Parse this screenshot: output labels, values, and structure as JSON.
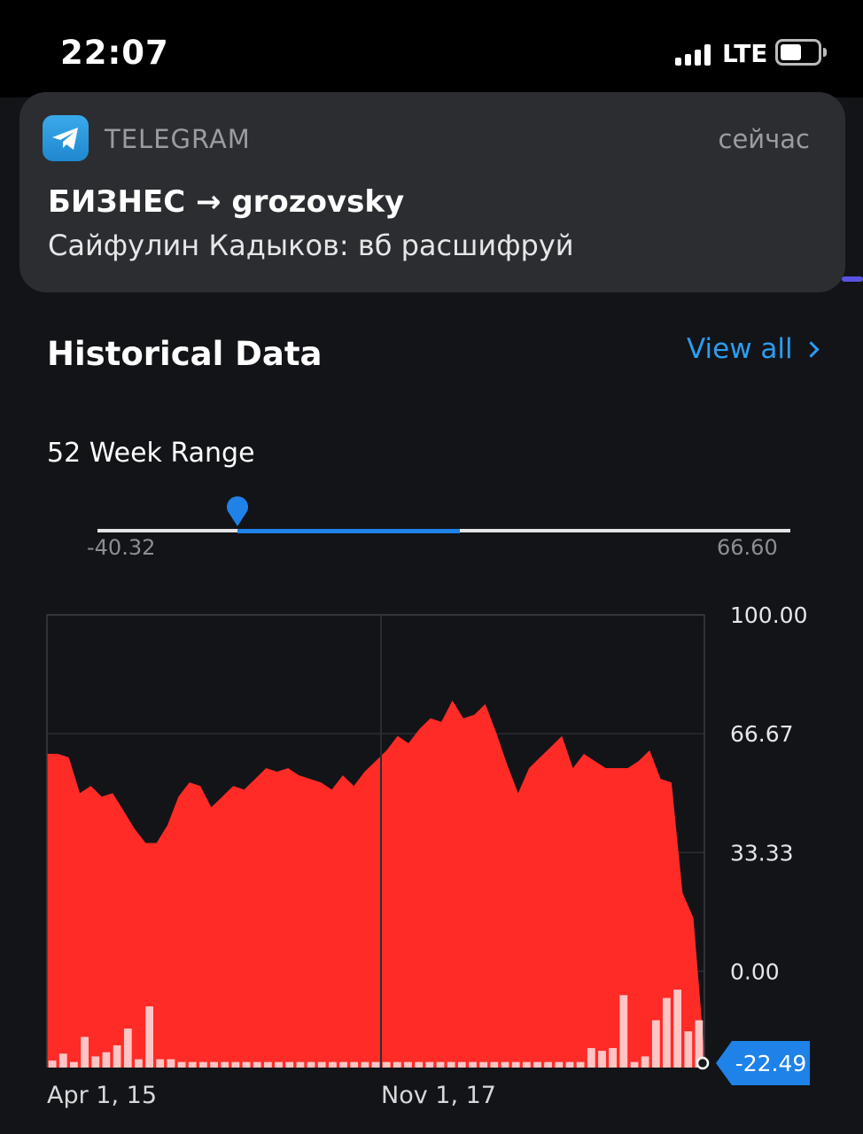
{
  "status_bar": {
    "time": "22:07",
    "network": "LTE"
  },
  "notification": {
    "app_name": "TELEGRAM",
    "time": "сейчас",
    "title": "БИЗНЕС → grozovsky",
    "body": "Сайфулин Кадыков: вб расшифруй"
  },
  "section": {
    "title": "Historical Data",
    "view_all": "View all"
  },
  "range": {
    "label": "52 Week Range",
    "min": "-40.32",
    "max": "66.60"
  },
  "colors": {
    "area": "#fe2b26",
    "accent": "#1e82e8",
    "link": "#2c9df0",
    "volume": "#ffc4c4"
  },
  "chart_data": {
    "type": "area",
    "x_tick_labels": [
      "Apr 1, 15",
      "Nov 1, 17"
    ],
    "y_tick_labels": [
      "100.00",
      "66.67",
      "33.33",
      "0.00"
    ],
    "ylim": [
      -27,
      100
    ],
    "current_value": "-22.49",
    "series": [
      {
        "values": [
          61,
          61,
          60,
          50,
          52,
          49,
          50,
          45,
          40,
          36,
          36,
          41,
          49,
          53,
          52,
          46,
          49,
          52,
          51,
          54,
          57,
          56,
          57,
          55,
          54,
          53,
          51,
          55,
          52,
          56,
          59,
          62,
          66,
          64,
          68,
          71,
          70,
          76,
          71,
          72,
          75,
          67,
          58,
          50,
          57,
          60,
          63,
          66,
          57,
          61,
          59,
          57,
          57,
          57,
          59,
          62,
          54,
          53,
          22,
          15,
          -23
        ],
        "volume": [
          2.5,
          5,
          2,
          11,
          4,
          5.5,
          8,
          14,
          3,
          22,
          3,
          3,
          2,
          2,
          2,
          2,
          2,
          2,
          2,
          2,
          2,
          2,
          2,
          2,
          2,
          2,
          2,
          2,
          2,
          2,
          2,
          2,
          2,
          2,
          2,
          2,
          2,
          2,
          2,
          2,
          2,
          2,
          2,
          2,
          2,
          2,
          2,
          2,
          2,
          2,
          7,
          6,
          7,
          26,
          2,
          4,
          17,
          25,
          28,
          13,
          17
        ]
      }
    ]
  }
}
